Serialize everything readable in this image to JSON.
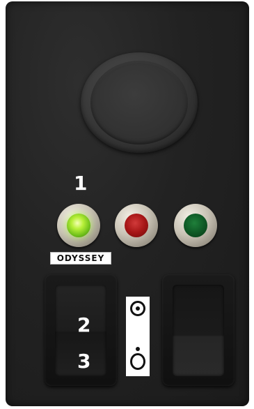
{
  "panel": {
    "top_label": "1",
    "brand_label": "ODYSSEY",
    "rocker_left_top_label": "2",
    "rocker_left_bottom_label": "3"
  },
  "colors": {
    "panel": "#222222",
    "lamp_green": "#b8f03a",
    "lamp_red": "#a61616",
    "lamp_dark_green": "#0f5a26",
    "label_text": "#ffffff"
  },
  "icons": {
    "indicator_top": "on-symbol-icon",
    "indicator_bottom": "off-symbol-icon"
  },
  "state": {
    "lamp_green_lit": true,
    "lamp_red_lit": false,
    "lamp_dark_green_lit": false
  }
}
